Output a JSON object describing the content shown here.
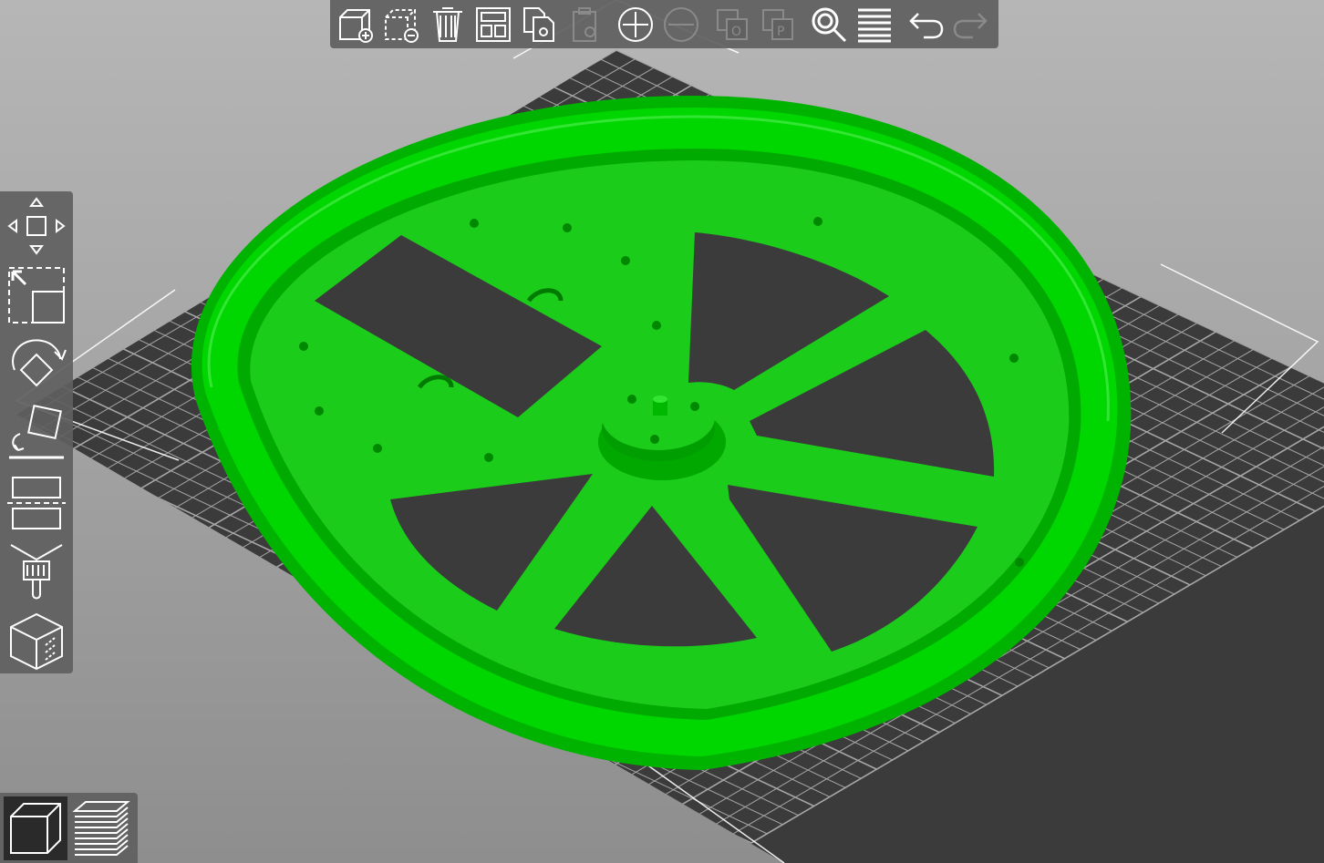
{
  "scene": {
    "bed_color": "#3b3b3b",
    "grid_color": "#ffffff",
    "model_color": "#00cc00",
    "model_shadow": "#009a00",
    "model_highlight": "#33e633"
  },
  "top_toolbar": [
    {
      "icon": "add-icon",
      "enabled": true
    },
    {
      "icon": "delete-icon",
      "enabled": true
    },
    {
      "icon": "delete-all-icon",
      "enabled": true
    },
    {
      "icon": "arrange-icon",
      "enabled": true
    },
    {
      "icon": "copy-icon",
      "enabled": true
    },
    {
      "icon": "paste-icon",
      "enabled": false
    },
    {
      "icon": "add-instance-icon",
      "enabled": true
    },
    {
      "icon": "remove-instance-icon",
      "enabled": false
    },
    {
      "icon": "split-objects-icon",
      "enabled": false
    },
    {
      "icon": "split-parts-icon",
      "enabled": false
    },
    {
      "icon": "search-icon",
      "enabled": true
    },
    {
      "icon": "layers-editing-icon",
      "enabled": true
    },
    {
      "icon": "undo-icon",
      "enabled": true
    },
    {
      "icon": "redo-icon",
      "enabled": false
    }
  ],
  "left_toolbar": [
    {
      "icon": "move-icon"
    },
    {
      "icon": "scale-icon"
    },
    {
      "icon": "rotate-icon"
    },
    {
      "icon": "place-on-face-icon"
    },
    {
      "icon": "cut-icon"
    },
    {
      "icon": "paint-supports-icon"
    },
    {
      "icon": "seam-painting-icon"
    }
  ],
  "view_toggle": [
    {
      "icon": "3d-view-icon",
      "active": true
    },
    {
      "icon": "preview-layers-icon",
      "active": false
    }
  ]
}
